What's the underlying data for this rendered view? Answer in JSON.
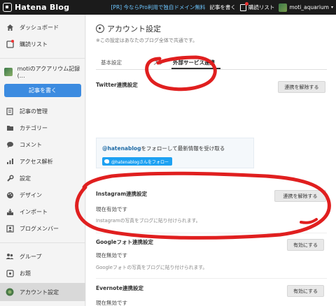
{
  "topbar": {
    "logo_text": "Hatena Blog",
    "promo": "[PR] 今ならPro利用で独自ドメイン無料",
    "write_link": "記事を書く",
    "reading_list": "購読リスト",
    "username": "moti_aquarium",
    "username_caret": "▾"
  },
  "sidebar": {
    "dashboard": "ダッシュボード",
    "reading_list": "購読リスト",
    "blog_name": "motiのアクアリウム記録(…",
    "write_button": "記事を書く",
    "manage_posts": "記事の管理",
    "categories": "カテゴリー",
    "comments": "コメント",
    "analytics": "アクセス解析",
    "settings": "設定",
    "design": "デザイン",
    "import": "インポート",
    "blog_members": "ブログメンバー",
    "groups": "グループ",
    "topics": "お題",
    "account_settings": "アカウント設定"
  },
  "main": {
    "title": "アカウント設定",
    "subtitle": "※この設定はあなたのブログ全体で共通です。",
    "tabs": [
      "基本設定",
      "プラ",
      "外部サービス連携"
    ],
    "twitter": {
      "title": "Twitter連携設定",
      "button": "連携を解除する",
      "follow_prefix": "@hatenablog",
      "follow_text": "をフォローして最新情報を受け取る",
      "follow_button": "@hatenablogさんをフォロー"
    },
    "instagram": {
      "title": "Instagram連携設定",
      "button": "連携を解除する",
      "status": "現在有効です",
      "note": "Instagramの写真をブログに貼り付けられます。"
    },
    "google_photos": {
      "title": "Googleフォト連携設定",
      "button": "有効にする",
      "status": "現在無効です",
      "note": "Googleフォトの写真をブログに貼り付けられます。"
    },
    "evernote": {
      "title": "Evernote連携設定",
      "button": "有効にする",
      "status": "現在無効です"
    }
  },
  "colors": {
    "topbar_bg": "#1b1b1b",
    "accent_blue": "#3c8be0",
    "promo_blue": "#6ec6ff",
    "annotation_red": "#e01f1f"
  }
}
